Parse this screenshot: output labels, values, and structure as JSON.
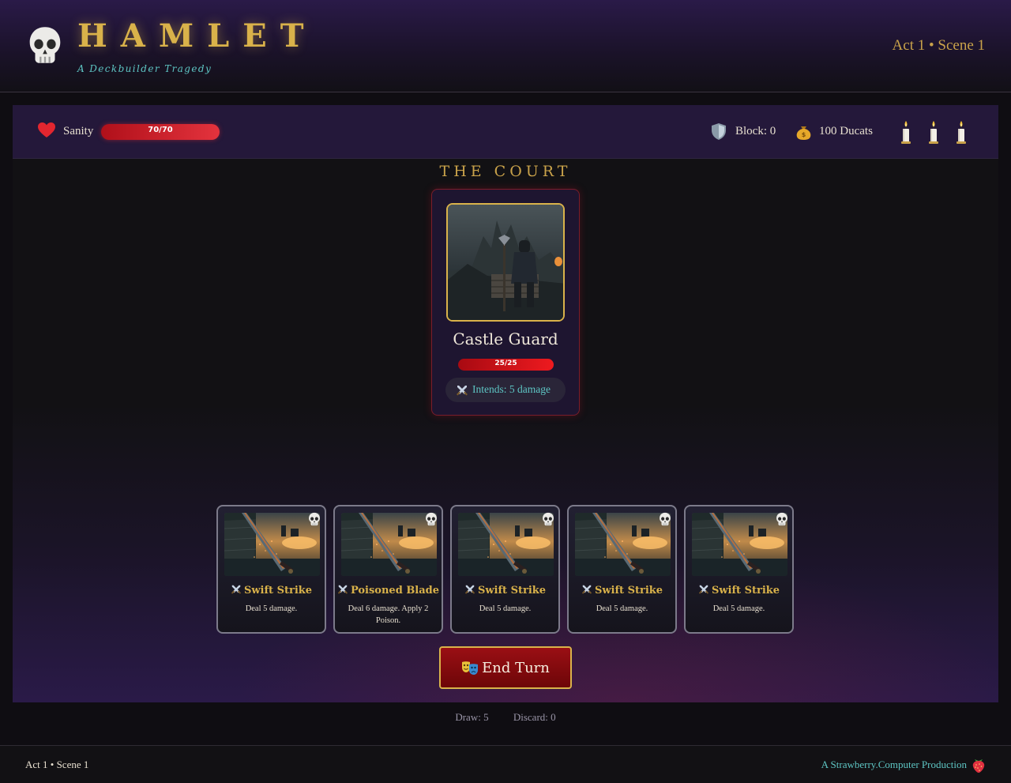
{
  "header": {
    "title": "HAMLET",
    "subtitle": "A Deckbuilder Tragedy",
    "act_scene": "Act 1 • Scene 1",
    "logo_icon": "skull-icon"
  },
  "status": {
    "sanity_label": "Sanity",
    "sanity_text": "70/70",
    "sanity_current": 70,
    "sanity_max": 70,
    "block_label": "Block: 0",
    "ducats_label": "100 Ducats",
    "candles": 3
  },
  "location": "THE COURT",
  "enemy": {
    "name": "Castle Guard",
    "hp_text": "25/25",
    "hp_current": 25,
    "hp_max": 25,
    "intent": "Intends: 5 damage"
  },
  "hand": [
    {
      "title": "Swift Strike",
      "desc": "Deal 5 damage."
    },
    {
      "title": "Poisoned Blade",
      "desc": "Deal 6 damage. Apply 2 Poison."
    },
    {
      "title": "Swift Strike",
      "desc": "Deal 5 damage."
    },
    {
      "title": "Swift Strike",
      "desc": "Deal 5 damage."
    },
    {
      "title": "Swift Strike",
      "desc": "Deal 5 damage."
    }
  ],
  "end_turn_label": "End Turn",
  "piles": {
    "draw": "Draw: 5",
    "discard": "Discard: 0"
  },
  "footer": {
    "left": "Act 1 • Scene 1",
    "right": "A Strawberry.Computer Production"
  },
  "colors": {
    "gold": "#d9b24a",
    "teal": "#5ec6c4",
    "blood": "#9a0f14",
    "purple": "#24183a"
  }
}
